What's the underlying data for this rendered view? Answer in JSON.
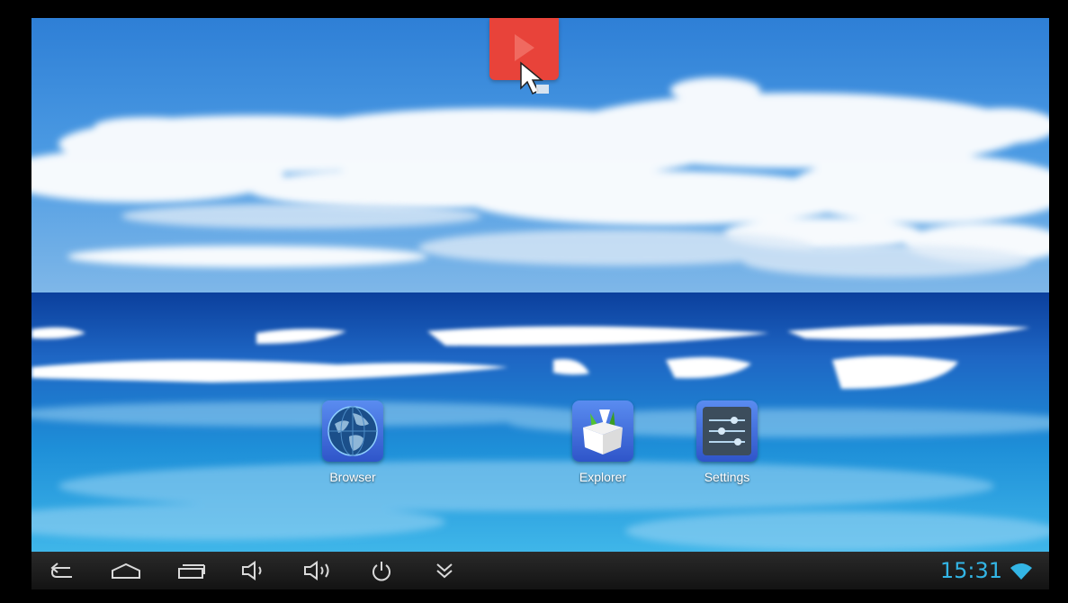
{
  "home": {
    "apps": [
      {
        "label": "Browser",
        "icon": "globe-icon"
      },
      {
        "label": "Explorer",
        "icon": "file-box-icon"
      },
      {
        "label": "Settings",
        "icon": "sliders-icon"
      }
    ],
    "floating_button": {
      "icon": "play-icon",
      "color": "#e8433a"
    }
  },
  "navbar": {
    "buttons": [
      "back-icon",
      "home-icon",
      "recents-icon",
      "volume-down-icon",
      "volume-up-icon",
      "power-icon",
      "collapse-icon"
    ],
    "clock": "15:31",
    "status_icon": "wifi-icon",
    "accent_color": "#33b5e5"
  }
}
